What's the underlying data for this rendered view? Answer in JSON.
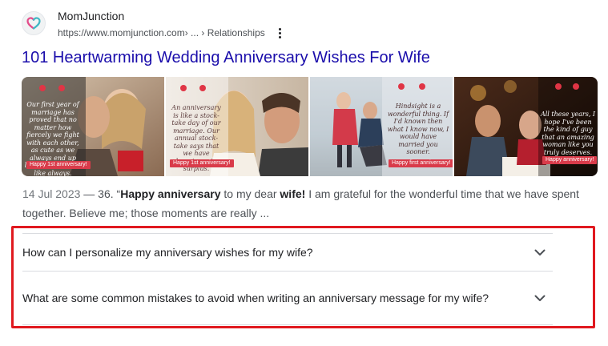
{
  "result": {
    "site_name": "MomJunction",
    "url_domain": "https://www.momjunction.com",
    "url_path": " › ... › Relationships",
    "title": "101 Heartwarming Wedding Anniversary Wishes For Wife",
    "link_color": "#1a0dab"
  },
  "images": [
    {
      "quote": "Our first year of marriage has proved that no matter how fiercely we fight with each other, as cute as we always end up loving each other like always.",
      "badge": "Happy 1st anniversary!"
    },
    {
      "quote": "An anniversary is like a stock-take day of our marriage. Our annual stock-take says that we have happiness in surplus.",
      "badge": "Happy 1st anniversary!"
    },
    {
      "quote": "Hindsight is a wonderful thing. If I'd known then what I know now, I would have married you sooner.",
      "badge": "Happy first anniversary!"
    },
    {
      "quote": "All these years, I hope I've been the kind of guy that an amazing woman like you truly deserves.",
      "badge": "Happy anniversary!"
    }
  ],
  "snippet": {
    "date": "14 Jul 2023",
    "sep": " — 36. “",
    "b1": "Happy anniversary",
    "t1": " to my dear ",
    "b2": "wife!",
    "t2": " I am grateful for the wonderful time that we have spent together. Believe me; those moments are really ..."
  },
  "faqs": [
    {
      "question": "How can I personalize my anniversary wishes for my wife?"
    },
    {
      "question": "What are some common mistakes to avoid when writing an anniversary message for my wife?"
    }
  ],
  "icons": {
    "favicon": "heart-logo-icon",
    "more": "more-vert-icon",
    "expand": "chevron-down-icon"
  },
  "colors": {
    "highlight_border": "#e0191f",
    "badge": "#d93b4a",
    "brand_pink": "#e44c8a",
    "brand_teal": "#41b7c4"
  }
}
